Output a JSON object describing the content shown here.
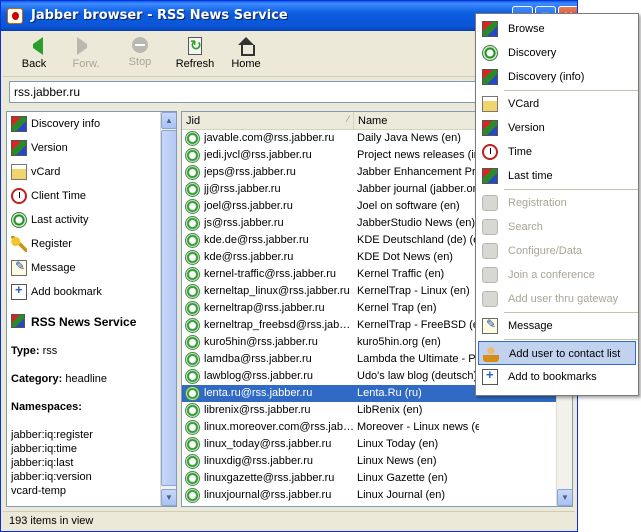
{
  "window": {
    "title": "Jabber browser - RSS News Service",
    "btn_min": "_",
    "btn_max": "□",
    "btn_close": "✕"
  },
  "toolbar": {
    "back": "Back",
    "forward": "Forw.",
    "stop": "Stop",
    "refresh": "Refresh",
    "home": "Home"
  },
  "address": {
    "value": "rss.jabber.ru"
  },
  "left_panel": {
    "items": [
      {
        "label": "Discovery info",
        "icon": "discovery-info-icon"
      },
      {
        "label": "Version",
        "icon": "version-icon"
      },
      {
        "label": "vCard",
        "icon": "vcard-icon"
      },
      {
        "label": "Client Time",
        "icon": "clock-icon"
      },
      {
        "label": "Last activity",
        "icon": "last-activity-icon"
      },
      {
        "label": "Register",
        "icon": "key-icon"
      },
      {
        "label": "Message",
        "icon": "message-icon"
      },
      {
        "label": "Add bookmark",
        "icon": "bookmark-icon"
      }
    ],
    "service_name": "RSS News Service",
    "type_label": "Type:",
    "type_value": "rss",
    "category_label": "Category:",
    "category_value": "headline",
    "namespaces_label": "Namespaces:",
    "namespaces": [
      "jabber:iq:register",
      "jabber:iq:time",
      "jabber:iq:last",
      "jabber:iq:version",
      "vcard-temp"
    ]
  },
  "grid": {
    "columns": {
      "jid": "Jid",
      "name": "Name"
    },
    "rows": [
      {
        "jid": "javable.com@rss.jabber.ru",
        "name": "Daily Java News (en)"
      },
      {
        "jid": "jedi.jvcl@rss.jabber.ru",
        "name": "Project news releases (in."
      },
      {
        "jid": "jeps@rss.jabber.ru",
        "name": "Jabber Enhancement Pro"
      },
      {
        "jid": "jj@rss.jabber.ru",
        "name": "Jabber journal (jabber.org"
      },
      {
        "jid": "joel@rss.jabber.ru",
        "name": "Joel on software (en)"
      },
      {
        "jid": "js@rss.jabber.ru",
        "name": "JabberStudio News (en)"
      },
      {
        "jid": "kde.de@rss.jabber.ru",
        "name": "KDE Deutschland (de) (en"
      },
      {
        "jid": "kde@rss.jabber.ru",
        "name": "KDE Dot News (en)"
      },
      {
        "jid": "kernel-traffic@rss.jabber.ru",
        "name": "Kernel Traffic (en)"
      },
      {
        "jid": "kerneltap_linux@rss.jabber.ru",
        "name": "KernelTrap - Linux (en)"
      },
      {
        "jid": "kerneltrap@rss.jabber.ru",
        "name": "Kernel Trap (en)"
      },
      {
        "jid": "kerneltrap_freebsd@rss.jabb...",
        "name": "KernelTrap - FreeBSD (en"
      },
      {
        "jid": "kuro5hin@rss.jabber.ru",
        "name": "kuro5hin.org (en)"
      },
      {
        "jid": "lamdba@rss.jabber.ru",
        "name": "Lambda the Ultimate - Pr."
      },
      {
        "jid": "lawblog@rss.jabber.ru",
        "name": "Udo's law blog (deutsch)"
      },
      {
        "jid": "lenta.ru@rss.jabber.ru",
        "name": "Lenta.Ru (ru)",
        "selected": true
      },
      {
        "jid": "librenix@rss.jabber.ru",
        "name": "LibRenix (en)"
      },
      {
        "jid": "linux.moreover.com@rss.jabb...",
        "name": "Moreover - Linux news (en"
      },
      {
        "jid": "linux_today@rss.jabber.ru",
        "name": "Linux Today (en)"
      },
      {
        "jid": "linuxdig@rss.jabber.ru",
        "name": "Linux News (en)"
      },
      {
        "jid": "linuxgazette@rss.jabber.ru",
        "name": "Linux Gazette (en)"
      },
      {
        "jid": "linuxjournal@rss.jabber.ru",
        "name": "Linux Journal (en)"
      }
    ]
  },
  "status": {
    "text": "193 items in view"
  },
  "context_menu": {
    "items": [
      {
        "label": "Browse",
        "icon": "browse-icon",
        "disabled": false
      },
      {
        "label": "Discovery",
        "icon": "discovery-icon",
        "disabled": false
      },
      {
        "label": "Discovery (info)",
        "icon": "discovery-info-icon",
        "disabled": false
      },
      {
        "sep": true
      },
      {
        "label": "VCard",
        "icon": "vcard-icon",
        "disabled": false
      },
      {
        "label": "Version",
        "icon": "version-icon",
        "disabled": false
      },
      {
        "label": "Time",
        "icon": "clock-icon",
        "disabled": false
      },
      {
        "label": "Last time",
        "icon": "last-time-icon",
        "disabled": false
      },
      {
        "sep": true
      },
      {
        "label": "Registration",
        "icon": "registration-icon",
        "disabled": true
      },
      {
        "label": "Search",
        "icon": "search-icon",
        "disabled": true
      },
      {
        "label": "Configure/Data",
        "icon": "configure-icon",
        "disabled": true
      },
      {
        "label": "Join a conference",
        "icon": "conference-icon",
        "disabled": true
      },
      {
        "label": "Add user thru gateway",
        "icon": "gateway-icon",
        "disabled": true
      },
      {
        "sep": true
      },
      {
        "label": "Message",
        "icon": "message-icon",
        "disabled": false
      },
      {
        "sep": true
      },
      {
        "label": "Add user to contact list",
        "icon": "add-user-icon",
        "disabled": false,
        "highlighted": true
      },
      {
        "label": "Add to bookmarks",
        "icon": "bookmark-icon",
        "disabled": false
      }
    ]
  }
}
